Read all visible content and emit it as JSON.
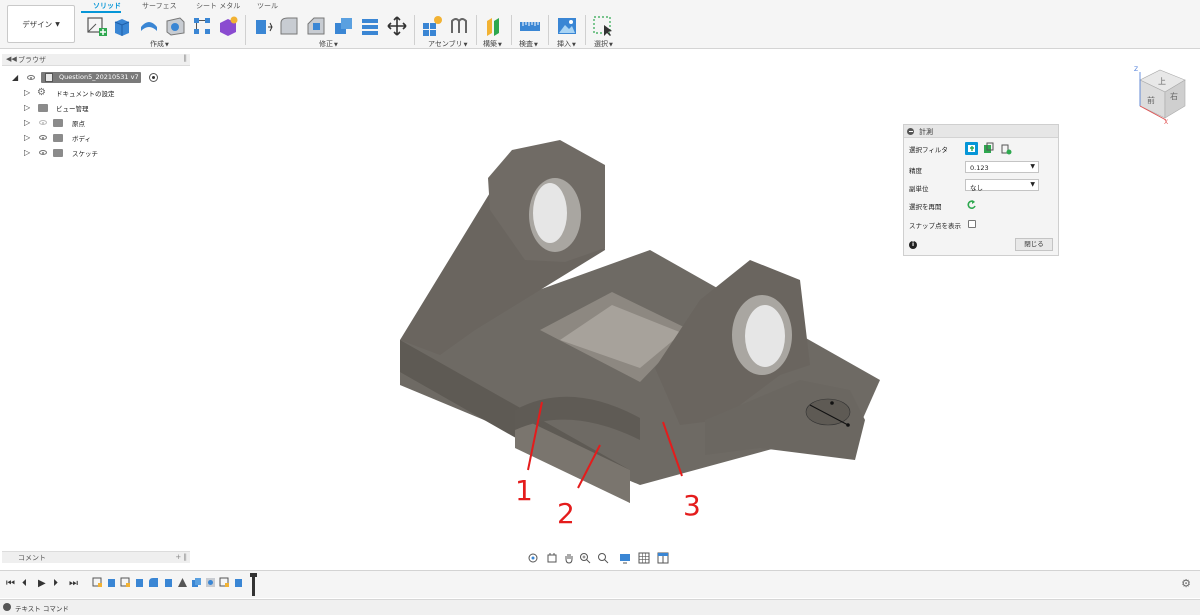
{
  "toolbar": {
    "workspace_label": "デザイン",
    "tabs": [
      {
        "label": "ソリッド",
        "active": true
      },
      {
        "label": "サーフェス",
        "active": false
      },
      {
        "label": "シート メタル",
        "active": false
      },
      {
        "label": "ツール",
        "active": false
      }
    ],
    "groups": {
      "create": "作成",
      "modify": "修正",
      "assemble": "アセンブリ",
      "construct": "構築",
      "inspect": "検査",
      "insert": "挿入",
      "select": "選択"
    }
  },
  "browser": {
    "title": "ブラウザ",
    "root_label": "Question5_20210531 v7",
    "items": [
      {
        "label": "ドキュメントの設定",
        "icon": "gear-icon"
      },
      {
        "label": "ビュー管理",
        "icon": "folder-icon"
      },
      {
        "label": "原点",
        "icon": "folder-icon"
      },
      {
        "label": "ボディ",
        "icon": "folder-icon"
      },
      {
        "label": "スケッチ",
        "icon": "folder-icon"
      }
    ]
  },
  "comments": {
    "title": "コメント"
  },
  "measure_panel": {
    "title": "計測",
    "filter_label": "選択フィルタ",
    "precision_label": "精度",
    "precision_value": "0.123",
    "alt_unit_label": "副単位",
    "alt_unit_value": "なし",
    "restart_label": "選択を再開",
    "snap_label": "スナップ点を表示",
    "close_label": "閉じる"
  },
  "viewcube": {
    "top": "上",
    "front": "前",
    "right": "右",
    "axis_z": "Z",
    "axis_x": "X"
  },
  "annotations": [
    "1",
    "2",
    "3"
  ],
  "text_command": {
    "label": "テキスト コマンド"
  },
  "colors": {
    "accent": "#0696d7",
    "annotation": "#e41c1c",
    "part_body": "#6f6a64"
  }
}
